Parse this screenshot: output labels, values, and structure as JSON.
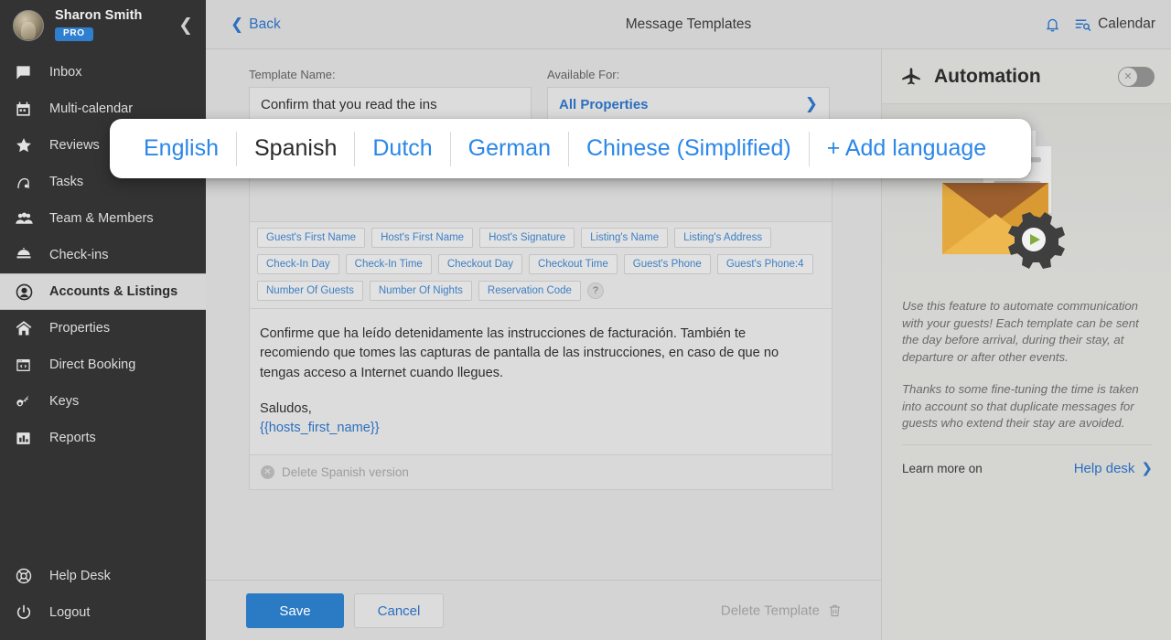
{
  "sidebar": {
    "profile": {
      "name": "Sharon Smith",
      "badge": "PRO",
      "collapse_icon": "chevron-left-icon"
    },
    "items": [
      {
        "label": "Inbox",
        "icon": "chat-icon",
        "active": false
      },
      {
        "label": "Multi-calendar",
        "icon": "calendar-icon",
        "active": false
      },
      {
        "label": "Reviews",
        "icon": "star-icon",
        "active": false
      },
      {
        "label": "Tasks",
        "icon": "vacuum-icon",
        "active": false
      },
      {
        "label": "Team & Members",
        "icon": "people-icon",
        "active": false
      },
      {
        "label": "Check-ins",
        "icon": "bell-desk-icon",
        "active": false
      },
      {
        "label": "Accounts & Listings",
        "icon": "user-circle-icon",
        "active": true
      },
      {
        "label": "Properties",
        "icon": "home-icon",
        "active": false
      },
      {
        "label": "Direct Booking",
        "icon": "code-window-icon",
        "active": false
      },
      {
        "label": "Keys",
        "icon": "key-icon",
        "active": false
      },
      {
        "label": "Reports",
        "icon": "bar-chart-icon",
        "active": false
      }
    ],
    "bottom_items": [
      {
        "label": "Help Desk",
        "icon": "lifebuoy-icon"
      },
      {
        "label": "Logout",
        "icon": "power-icon"
      }
    ]
  },
  "topbar": {
    "back_label": "Back",
    "title": "Message Templates",
    "bell_icon": "notification-bell-icon",
    "calendar_icon": "calendar-search-icon",
    "calendar_label": "Calendar"
  },
  "form": {
    "template_name_label": "Template Name:",
    "template_name_value": "Confirm that you read the ins",
    "available_for_label": "Available For:",
    "available_for_value": "All Properties"
  },
  "languages": {
    "items": [
      {
        "label": "English",
        "active": false
      },
      {
        "label": "Spanish",
        "active": true
      },
      {
        "label": "Dutch",
        "active": false
      },
      {
        "label": "German",
        "active": false
      },
      {
        "label": "Chinese (Simplified)",
        "active": false
      }
    ],
    "add_label": "+ Add language"
  },
  "tags": {
    "row1": [
      "Guest's First Name",
      "Host's First Name",
      "Host's Signature",
      "Listing's Name",
      "Listing's Address"
    ],
    "row2": [
      "Check-In Day",
      "Check-In Time",
      "Checkout Day",
      "Checkout Time",
      "Guest's Phone",
      "Guest's Phone:4"
    ],
    "row3": [
      "Number Of Guests",
      "Number Of Nights",
      "Reservation Code"
    ],
    "help_label": "?"
  },
  "message": {
    "paragraph1": "Confirme que ha leído detenidamente las instrucciones de facturación. También te recomiendo que tomes las capturas de pantalla de las instrucciones, en caso de que no tengas acceso a Internet cuando llegues.",
    "signoff": "Saludos,",
    "variable": "{{hosts_first_name}}",
    "delete_version_label": "Delete Spanish version"
  },
  "actions": {
    "save_label": "Save",
    "cancel_label": "Cancel",
    "delete_template_label": "Delete Template",
    "trash_icon": "trash-icon"
  },
  "automation": {
    "plane_icon": "airplane-icon",
    "title": "Automation",
    "toggle_state": "off",
    "toggle_icon": "close-x-icon",
    "illustration": "envelope-gear-illustration",
    "paragraph1": "Use this feature to automate communication with your guests! Each template can be sent the day before arrival, during their stay, at departure or after other events.",
    "paragraph2": "Thanks to some fine-tuning the time is taken into account so that duplicate messages for guests who extend their stay are avoided.",
    "learn_more_label": "Learn more on",
    "help_desk_label": "Help desk"
  },
  "colors": {
    "accent_blue": "#2b7ac4",
    "link_blue": "#2b6fc0",
    "popup_blue": "#2b87e8",
    "sidebar_bg": "#333333",
    "page_bg": "#d4d4d4"
  }
}
